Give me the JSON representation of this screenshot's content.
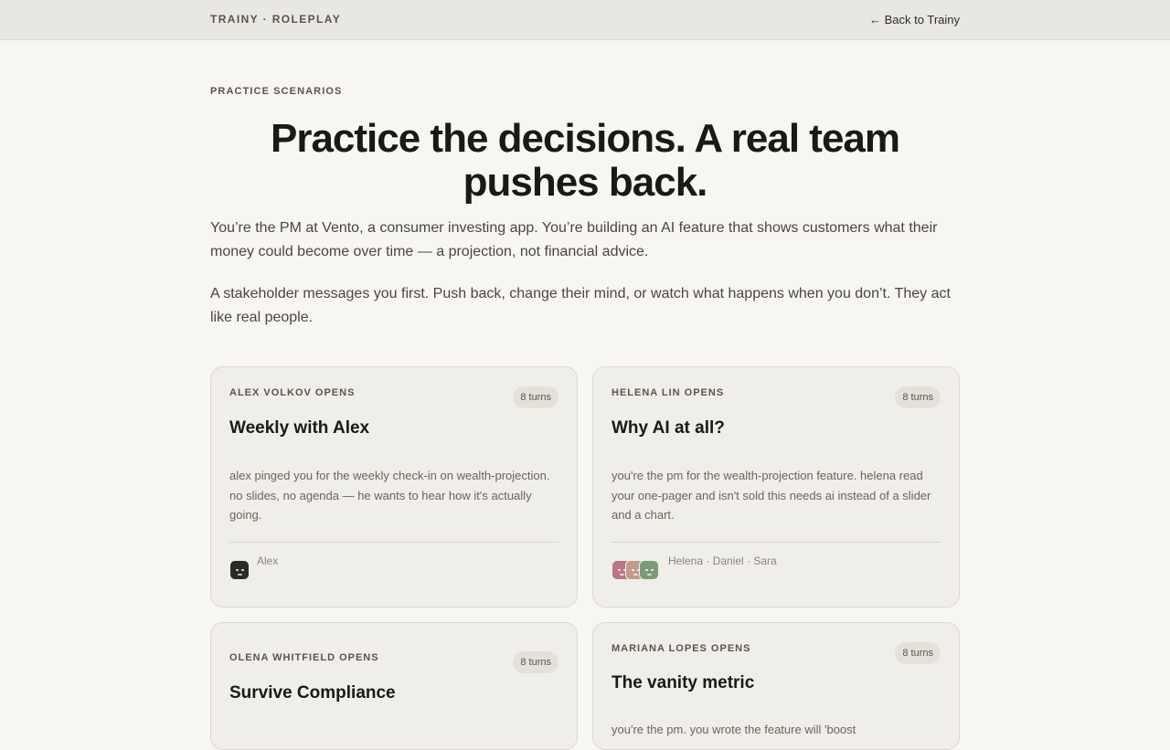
{
  "header": {
    "brand": "TRAINY · ROLEPLAY",
    "back_link": "← Back to Trainy"
  },
  "hero": {
    "eyebrow": "PRACTICE SCENARIOS",
    "title": "Practice the decisions. A real team pushes back.",
    "intro_1": "You’re the PM at Vento, a consumer investing app. You’re building an AI feature that shows customers what their money could become over time — a projection, not financial advice.",
    "intro_2": "A stakeholder messages you first. Push back, change their mind, or watch what happens when you don’t. They act like real people."
  },
  "scenarios": [
    {
      "opener": "ALEX VOLKOV OPENS",
      "turns": "8 turns",
      "title": "Weekly with Alex",
      "description": "alex pinged you for the weekly check-in on wealth-projection. no slides, no agenda — he wants to hear how it's actually going.",
      "participants": "Alex",
      "avatar_colors": [
        "#2b2a27"
      ]
    },
    {
      "opener": "HELENA LIN OPENS",
      "turns": "8 turns",
      "title": "Why AI at all?",
      "description": "you're the pm for the wealth-projection feature. helena read your one-pager and isn't sold this needs ai instead of a slider and a chart.",
      "participants": "Helena · Daniel · Sara",
      "avatar_colors": [
        "#b97882",
        "#c59a8c",
        "#7a9a78"
      ]
    },
    {
      "opener": "OLENA WHITFIELD OPENS",
      "turns": "8 turns",
      "title": "Survive Compliance",
      "description": "",
      "participants": ""
    },
    {
      "opener": "MARIANA LOPES OPENS",
      "turns": "8 turns",
      "title": "The vanity metric",
      "description": "you're the pm. you wrote the feature will 'boost",
      "participants": ""
    }
  ]
}
